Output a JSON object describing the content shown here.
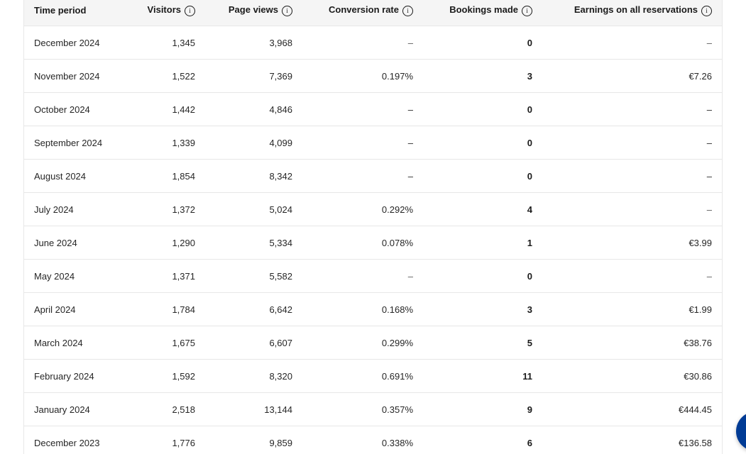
{
  "table": {
    "headers": [
      {
        "label": "Time period",
        "info": false
      },
      {
        "label": "Visitors",
        "info": true
      },
      {
        "label": "Page views",
        "info": true
      },
      {
        "label": "Conversion rate",
        "info": true
      },
      {
        "label": "Bookings made",
        "info": true
      },
      {
        "label": "Earnings on all reservations",
        "info": true
      }
    ],
    "rows": [
      {
        "period": "December 2024",
        "visitors": "1,345",
        "page_views": "3,968",
        "conversion": "–",
        "bookings": "0",
        "earnings": "–"
      },
      {
        "period": "November 2024",
        "visitors": "1,522",
        "page_views": "7,369",
        "conversion": "0.197%",
        "bookings": "3",
        "earnings": "€7.26"
      },
      {
        "period": "October 2024",
        "visitors": "1,442",
        "page_views": "4,846",
        "conversion": "–",
        "bookings": "0",
        "earnings": "–"
      },
      {
        "period": "September 2024",
        "visitors": "1,339",
        "page_views": "4,099",
        "conversion": "–",
        "bookings": "0",
        "earnings": "–"
      },
      {
        "period": "August 2024",
        "visitors": "1,854",
        "page_views": "8,342",
        "conversion": "–",
        "bookings": "0",
        "earnings": "–"
      },
      {
        "period": "July 2024",
        "visitors": "1,372",
        "page_views": "5,024",
        "conversion": "0.292%",
        "bookings": "4",
        "earnings": "–"
      },
      {
        "period": "June 2024",
        "visitors": "1,290",
        "page_views": "5,334",
        "conversion": "0.078%",
        "bookings": "1",
        "earnings": "€3.99"
      },
      {
        "period": "May 2024",
        "visitors": "1,371",
        "page_views": "5,582",
        "conversion": "–",
        "bookings": "0",
        "earnings": "–"
      },
      {
        "period": "April 2024",
        "visitors": "1,784",
        "page_views": "6,642",
        "conversion": "0.168%",
        "bookings": "3",
        "earnings": "€1.99"
      },
      {
        "period": "March 2024",
        "visitors": "1,675",
        "page_views": "6,607",
        "conversion": "0.299%",
        "bookings": "5",
        "earnings": "€38.76"
      },
      {
        "period": "February 2024",
        "visitors": "1,592",
        "page_views": "8,320",
        "conversion": "0.691%",
        "bookings": "11",
        "earnings": "€30.86"
      },
      {
        "period": "January 2024",
        "visitors": "2,518",
        "page_views": "13,144",
        "conversion": "0.357%",
        "bookings": "9",
        "earnings": "€444.45"
      },
      {
        "period": "December 2023",
        "visitors": "1,776",
        "page_views": "9,859",
        "conversion": "0.338%",
        "bookings": "6",
        "earnings": "€136.58"
      }
    ]
  },
  "icons": {
    "info_glyph": "i",
    "chat_icon": "chat-bubble-icon"
  },
  "colors": {
    "header_bg": "#f5f5f5",
    "border": "#e7e7e7",
    "chat_button": "#003b95"
  }
}
